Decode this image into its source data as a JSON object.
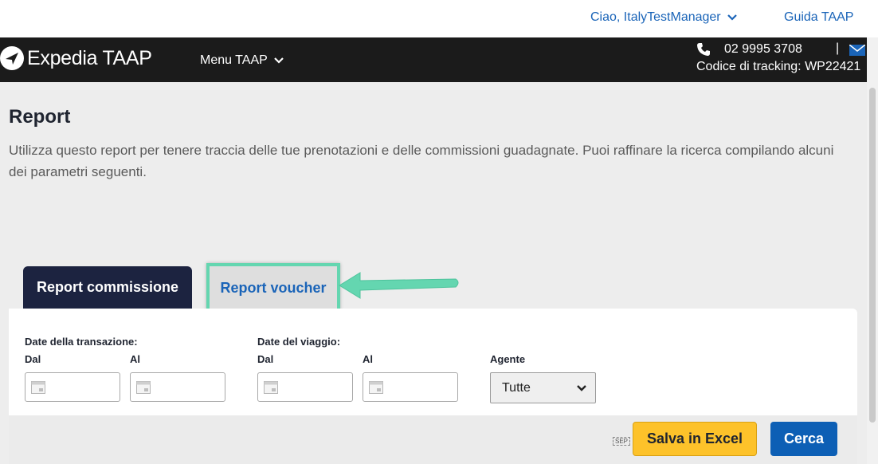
{
  "topbar": {
    "greeting": "Ciao, ItalyTestManager",
    "help_link": "Guida TAAP"
  },
  "header": {
    "logo_text": "Expedia TAAP",
    "menu_label": "Menu TAAP",
    "phone": "02 9995 3708",
    "separator": "|",
    "tracking": "Codice di tracking: WP22421"
  },
  "page": {
    "title": "Report",
    "description": "Utilizza questo report per tenere traccia delle tue prenotazioni e delle commissioni guadagnate. Puoi raffinare la ricerca compilando alcuni dei parametri seguenti."
  },
  "tabs": [
    {
      "label": "Report commissione",
      "active": true
    },
    {
      "label": "Report voucher",
      "active": false
    }
  ],
  "filters": {
    "transaction_dates_label": "Date della transazione:",
    "travel_dates_label": "Date del viaggio:",
    "from_label": "Dal",
    "to_label": "Al",
    "agent_label": "Agente",
    "agent_value": "Tutte"
  },
  "actions": {
    "sep_icon_text": "SEP",
    "excel_label": "Salva in Excel",
    "search_label": "Cerca"
  },
  "colors": {
    "accent_blue": "#1a64b8",
    "header_dark": "#1b1b1b",
    "tab_active": "#1c2340",
    "highlight_green": "#64d6b0",
    "excel_yellow": "#fdc22a",
    "search_blue": "#0d5fb5"
  },
  "icons": {
    "greeting_chevron": "chevron-down-icon",
    "menu_chevron": "chevron-down-icon",
    "phone": "phone-icon",
    "mail": "mail-icon",
    "calendar": "calendar-icon",
    "select_chevron": "chevron-down-icon",
    "annotation": "arrow-left-icon"
  }
}
